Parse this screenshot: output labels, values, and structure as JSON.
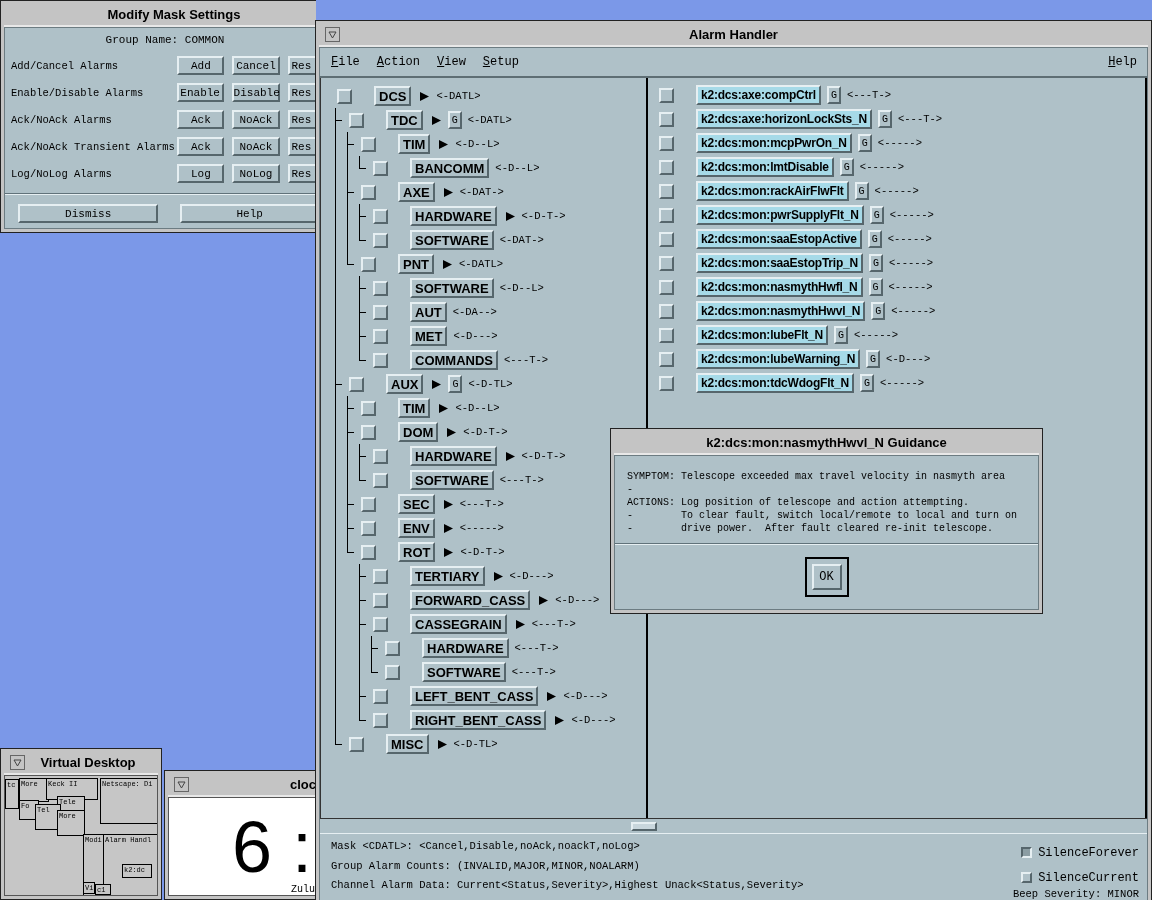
{
  "mask_settings": {
    "title": "Modify Mask Settings",
    "group_name": "Group Name: COMMON",
    "rows": [
      {
        "label": "Add/Cancel Alarms",
        "buttons": [
          "Add",
          "Cancel",
          "Res"
        ]
      },
      {
        "label": "Enable/Disable Alarms",
        "buttons": [
          "Enable",
          "Disable",
          "Res"
        ]
      },
      {
        "label": "Ack/NoAck Alarms",
        "buttons": [
          "Ack",
          "NoAck",
          "Res"
        ]
      },
      {
        "label": "Ack/NoAck Transient Alarms",
        "buttons": [
          "Ack",
          "NoAck",
          "Res"
        ]
      },
      {
        "label": "Log/NoLog Alarms",
        "buttons": [
          "Log",
          "NoLog",
          "Res"
        ]
      }
    ],
    "footer_buttons": [
      "Dismiss",
      "Help"
    ]
  },
  "alarm_handler": {
    "title": "Alarm Handler",
    "menus": [
      "File",
      "Action",
      "View",
      "Setup"
    ],
    "help_menu": "Help",
    "tree": [
      {
        "name": "DCS",
        "checked": false,
        "expandable": true,
        "mask": "<-DATL>",
        "children": [
          {
            "name": "TDC",
            "checked": false,
            "expandable": true,
            "guidance": "G",
            "mask": "<-DATL>",
            "children": [
              {
                "name": "TIM",
                "checked": false,
                "expandable": true,
                "mask": "<-D--L>",
                "children": [
                  {
                    "name": "BANCOMM",
                    "checked": false,
                    "expandable": false,
                    "mask": "<-D--L>"
                  }
                ]
              },
              {
                "name": "AXE",
                "checked": false,
                "expandable": true,
                "mask": "<-DAT->",
                "children": [
                  {
                    "name": "HARDWARE",
                    "checked": false,
                    "expandable": true,
                    "mask": "<-D-T->"
                  },
                  {
                    "name": "SOFTWARE",
                    "checked": false,
                    "expandable": false,
                    "mask": "<-DAT->"
                  }
                ]
              },
              {
                "name": "PNT",
                "checked": false,
                "expandable": true,
                "mask": "<-DATL>",
                "children": [
                  {
                    "name": "SOFTWARE",
                    "checked": false,
                    "expandable": false,
                    "mask": "<-D--L>"
                  },
                  {
                    "name": "AUT",
                    "checked": false,
                    "expandable": false,
                    "mask": "<-DA-->"
                  },
                  {
                    "name": "MET",
                    "checked": false,
                    "expandable": false,
                    "mask": "<-D--->"
                  },
                  {
                    "name": "COMMANDS",
                    "checked": false,
                    "expandable": false,
                    "mask": "<---T->"
                  }
                ]
              }
            ]
          },
          {
            "name": "AUX",
            "checked": false,
            "expandable": true,
            "guidance": "G",
            "mask": "<-D-TL>",
            "children": [
              {
                "name": "TIM",
                "checked": false,
                "expandable": true,
                "mask": "<-D--L>"
              },
              {
                "name": "DOM",
                "checked": false,
                "expandable": true,
                "mask": "<-D-T->",
                "children": [
                  {
                    "name": "HARDWARE",
                    "checked": false,
                    "expandable": true,
                    "mask": "<-D-T->"
                  },
                  {
                    "name": "SOFTWARE",
                    "checked": false,
                    "expandable": false,
                    "mask": "<---T->"
                  }
                ]
              },
              {
                "name": "SEC",
                "checked": false,
                "expandable": true,
                "mask": "<---T->"
              },
              {
                "name": "ENV",
                "checked": false,
                "expandable": true,
                "mask": "<----->"
              },
              {
                "name": "ROT",
                "checked": false,
                "expandable": true,
                "mask": "<-D-T->",
                "children": [
                  {
                    "name": "TERTIARY",
                    "checked": false,
                    "expandable": true,
                    "mask": "<-D--->"
                  },
                  {
                    "name": "FORWARD_CASS",
                    "checked": false,
                    "expandable": true,
                    "mask": "<-D--->"
                  },
                  {
                    "name": "CASSEGRAIN",
                    "checked": false,
                    "expandable": true,
                    "mask": "<---T->",
                    "children": [
                      {
                        "name": "HARDWARE",
                        "checked": false,
                        "expandable": false,
                        "mask": "<---T->"
                      },
                      {
                        "name": "SOFTWARE",
                        "checked": false,
                        "expandable": false,
                        "mask": "<---T->"
                      }
                    ]
                  },
                  {
                    "name": "LEFT_BENT_CASS",
                    "checked": false,
                    "expandable": true,
                    "mask": "<-D--->"
                  },
                  {
                    "name": "RIGHT_BENT_CASS",
                    "checked": false,
                    "expandable": true,
                    "mask": "<-D--->"
                  }
                ]
              }
            ]
          },
          {
            "name": "MISC",
            "checked": false,
            "expandable": true,
            "mask": "<-D-TL>"
          }
        ]
      }
    ],
    "channels": [
      {
        "name": "k2:dcs:axe:compCtrl",
        "checked": false,
        "guidance": "G",
        "mask": "<---T->"
      },
      {
        "name": "k2:dcs:axe:horizonLockSts_N",
        "checked": false,
        "guidance": "G",
        "mask": "<---T->"
      },
      {
        "name": "k2:dcs:mon:mcpPwrOn_N",
        "checked": false,
        "guidance": "G",
        "mask": "<----->"
      },
      {
        "name": "k2:dcs:mon:lmtDisable",
        "checked": false,
        "guidance": "G",
        "mask": "<----->"
      },
      {
        "name": "k2:dcs:mon:rackAirFlwFlt",
        "checked": false,
        "guidance": "G",
        "mask": "<----->"
      },
      {
        "name": "k2:dcs:mon:pwrSupplyFlt_N",
        "checked": false,
        "guidance": "G",
        "mask": "<----->"
      },
      {
        "name": "k2:dcs:mon:saaEstopActive",
        "checked": false,
        "guidance": "G",
        "mask": "<----->"
      },
      {
        "name": "k2:dcs:mon:saaEstopTrip_N",
        "checked": false,
        "guidance": "G",
        "mask": "<----->"
      },
      {
        "name": "k2:dcs:mon:nasmythHwfl_N",
        "checked": false,
        "guidance": "G",
        "mask": "<----->"
      },
      {
        "name": "k2:dcs:mon:nasmythHwvl_N",
        "checked": false,
        "guidance": "G",
        "mask": "<----->"
      },
      {
        "name": "k2:dcs:mon:lubeFlt_N",
        "checked": false,
        "guidance": "G",
        "mask": "<----->"
      },
      {
        "name": "k2:dcs:mon:lubeWarning_N",
        "checked": false,
        "guidance": "G",
        "mask": "<-D--->"
      },
      {
        "name": "k2:dcs:mon:tdcWdogFlt_N",
        "checked": false,
        "guidance": "G",
        "mask": "<----->"
      }
    ],
    "status_lines": [
      "Mask <CDATL>: <Cancel,Disable,noAck,noackT,noLog>",
      "Group Alarm Counts: (INVALID,MAJOR,MINOR,NOALARM)",
      "Channel Alarm Data: Current<Status,Severity>,Highest Unack<Status,Severity>"
    ],
    "silence_options": [
      {
        "label": "SilenceForever",
        "checked": true
      },
      {
        "label": "SilenceCurrent",
        "checked": false
      }
    ],
    "beep_severity": "Beep Severity: MINOR"
  },
  "guidance": {
    "title": "k2:dcs:mon:nasmythHwvl_N Guidance",
    "lines": [
      "SYMPTOM: Telescope exceeded max travel velocity in nasmyth area",
      "-",
      "ACTIONS: Log position of telescope and action attempting.",
      "-        To clear fault, switch local/remote to local and turn on",
      "-        drive power.  After fault cleared re-init telescope."
    ],
    "button": "OK"
  },
  "virtual_desktop": {
    "title": "Virtual Desktop",
    "mini_windows": [
      {
        "label": "tc"
      },
      {
        "label": "More"
      },
      {
        "label": "Keck II"
      },
      {
        "label": "Netscape: Di"
      },
      {
        "label": "Fo"
      },
      {
        "label": "Tele"
      },
      {
        "label": "Tel"
      },
      {
        "label": "More"
      },
      {
        "label": "Modi"
      },
      {
        "label": "Alarm Handl"
      },
      {
        "label": "k2:dc"
      },
      {
        "label": "Vi"
      },
      {
        "label": "c1"
      }
    ]
  },
  "clock": {
    "title": "cloc",
    "display": "6 :",
    "zone": "Zulu"
  }
}
